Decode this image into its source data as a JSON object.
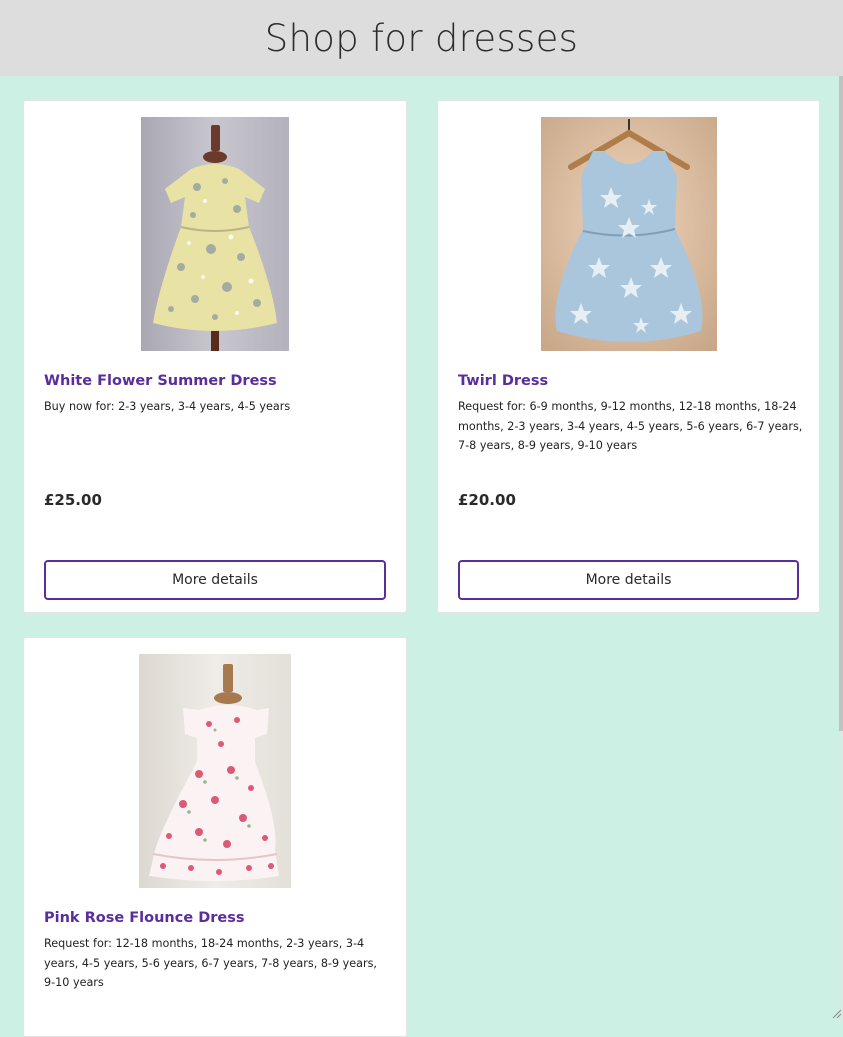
{
  "page": {
    "title": "Shop for dresses",
    "background_color": "#cdf0e5",
    "header_color": "#dddddd",
    "accent_color": "#5a2d9c"
  },
  "products": [
    {
      "name": "White Flower Summer Dress",
      "sizes": "Buy now for: 2-3 years, 3-4 years, 4-5 years",
      "price": "£25.00",
      "button_label": "More details",
      "image_alt": "Yellow floral summer dress on wooden mannequin"
    },
    {
      "name": "Twirl Dress",
      "sizes": "Request for: 6-9 months, 9-12 months, 12-18 months, 18-24 months, 2-3 years, 3-4 years, 4-5 years, 5-6 years, 6-7 years, 7-8 years, 8-9 years, 9-10 years",
      "price": "£20.00",
      "button_label": "More details",
      "image_alt": "Blue star print twirl dress on wooden hanger"
    },
    {
      "name": "Pink Rose Flounce Dress",
      "sizes": "Request for: 12-18 months, 18-24 months, 2-3 years, 3-4 years, 4-5 years, 5-6 years, 6-7 years, 7-8 years, 8-9 years, 9-10 years",
      "image_alt": "Pink rose print flounce dress on wooden mannequin"
    }
  ]
}
